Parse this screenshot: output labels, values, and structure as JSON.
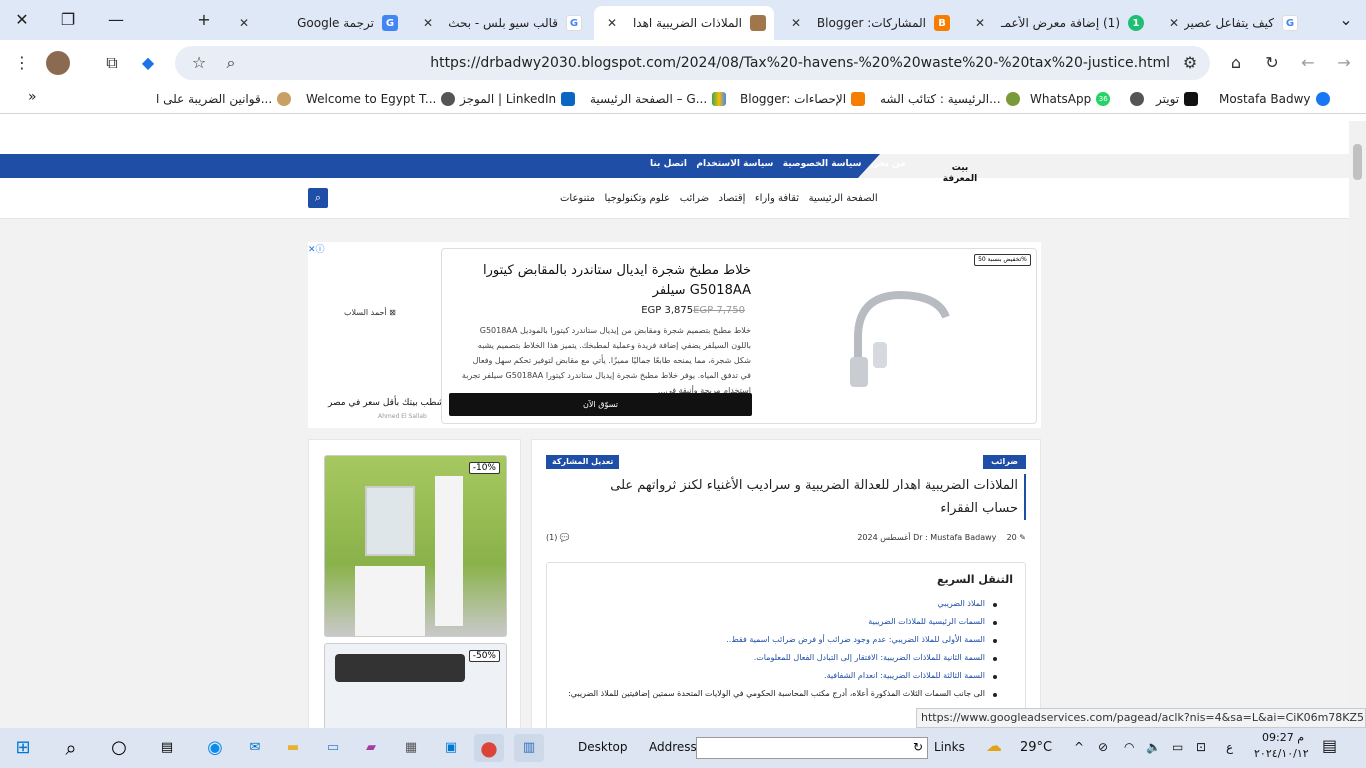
{
  "browser": {
    "tabs": [
      {
        "title": "كيف يتفاعل عصير الليمـ",
        "active": false
      },
      {
        "title": "(1) إضافة معرض الأعمـ",
        "active": false
      },
      {
        "title": "المشاركات: Blogger",
        "active": false
      },
      {
        "title": "الملاذات الضريبية اهدا",
        "active": true
      },
      {
        "title": "قالب سيو بلس - بحث",
        "active": false
      },
      {
        "title": "ترجمة Google",
        "active": false
      }
    ],
    "url": "https://drbadwy2030.blogspot.com/2024/08/Tax%20-havens-%20%20waste%20-%20tax%20-justice.html",
    "bookmarks": [
      "Mostafa Badwy",
      "تويتر",
      "WhatsApp",
      "الرئيسية : كتائب الشه...",
      "Blogger: الإحصاءات",
      "الصفحة الرئيسية – G...",
      "الموجز | LinkedIn",
      "Welcome to Egypt T...",
      "قوانين الضريبة على ا..."
    ],
    "whatsapp_badge": "36",
    "overflow": "»"
  },
  "site": {
    "top_links": [
      "من نحن",
      "سياسة الخصوصية",
      "سياسة الاستخدام",
      "اتصل بنا"
    ],
    "logo_text": "بيت المعرفة",
    "nav": [
      "الصفحة الرئيسية",
      "ثقافة واراء",
      "إقتصاد",
      "ضرائب",
      "علوم وتكنولوجيا",
      "متنوعات"
    ]
  },
  "ad": {
    "discount_badge": "تخفيض بنسبة 50%",
    "title": "خلاط مطبخ شجرة ايديال ستاندرد بالمقابض كيتورا G5018AA سيلفر",
    "price_new": "EGP 3,875",
    "price_old": "EGP 7,750",
    "description": "خلاط مطبخ بتصميم شجرة ومقابض من إيديال ستاندرد كيتورا بالموديل G5018AA باللون السيلفر يضفي إضافة فريدة وعملية لمطبخك. يتميز هذا الخلاط بتصميم يشبه شكل شجرة، مما يمنحه طابعًا جماليًا مميزًا. يأتي مع مقابض لتوفير تحكم سهل وفعال في تدفق المياه. يوفر خلاط مطبخ شجرة إيديال ستاندرد كيتورا G5018AA سيلفر تجربة استخدام مريحة وأنيقة في...",
    "cta": "تسوّق الآن",
    "brand_logo": "أحمد السلاب",
    "brand_tagline": "شطب بيتك بأقل سعر في مصر",
    "brand_name": "Ahmed El Sallab"
  },
  "sidebar_ads": [
    {
      "badge": "-10%"
    },
    {
      "badge": "-50%"
    }
  ],
  "post": {
    "category": "ضرائب",
    "edit_label": "تعديل المشاركة",
    "title": "الملاذات الضريبية اهدار للعدالة الضريبية و سراديب الأغنياء لكنز ثرواتهم على حساب الفقراء",
    "author": "Dr : Mustafa Badawy",
    "date": "20 أغسطس 2024",
    "comments": "(1)",
    "toc_title": "التنقل السريع",
    "toc_items": [
      "الملاذ الضريبي",
      "السمات الرئيسية للملاذات الضريبية",
      "السمة الأولى للملاذ الضريبي: عدم وجود ضرائب أو فرض ضرائب اسمية فقط..",
      "السمة الثانية للملاذات الضريبية: الافتقار إلى التبادل الفعال للمعلومات.",
      "السمة الثالثة للملاذات الضريبية: انعدام الشفافية.",
      "الى جانب السمات الثلاث المذكورة أعلاه، أدرج مكتب المحاسبة الحكومي في الولايات المتحدة سمتين إضافيتين للملاذ الضريبي:"
    ]
  },
  "status_url": "https://www.googleadservices.com/pagead/aclk?nis=4&sa=L&ai=CiK06m78KZ5P...",
  "taskbar": {
    "desktop_label": "Desktop",
    "address_label": "Address",
    "links_label": "Links",
    "temperature": "29°C",
    "lang": "ع",
    "time": "09:27 م",
    "date": "٢٠٢٤/١٠/١٢"
  }
}
